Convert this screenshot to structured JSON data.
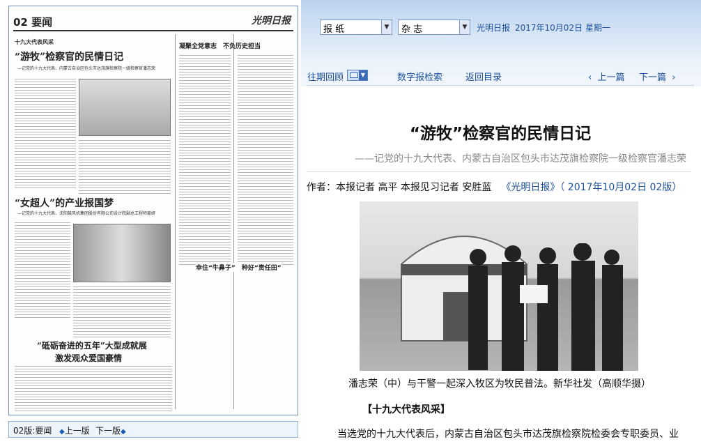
{
  "newspaper_page": {
    "page_label": "02 要闻",
    "masthead": "光明日报",
    "column_label": "十九大代表风采",
    "headline1": "“游牧”检察官的民情日记",
    "headline1_sub": "—记党的十九大代表、内蒙古自治区包头市达茂旗检察院一级检察官潘志荣",
    "headline2": "“女超人”的产业报国梦",
    "headline2_sub": "—记党的十九大代表、沈阳鼓风机集团股份有限公司设计院副总工程师姜妍",
    "headline3a": "“砥砺奋进的五年”大型成就展",
    "headline3b": "激发观众爱国豪情",
    "side_title1": "凝聚全党意志　不负历史担当",
    "side_title2": "幸住“牛鼻子”　种好“责任田”"
  },
  "left_footer": {
    "page": "02版:要闻",
    "prev": "上一版",
    "next": "下一版"
  },
  "top_bar": {
    "select_paper": "报 纸",
    "select_magazine": "杂 志",
    "paper_name": "光明日报",
    "date": "2017年10月02日",
    "weekday": "星期一"
  },
  "nav": {
    "back_issues": "往期回顾",
    "digital_search": "数字报检索",
    "return_toc": "返回目录",
    "prev_page": "上一篇",
    "next_page": "下一篇"
  },
  "article": {
    "title": "“游牧”检察官的民情日记",
    "subtitle": "——记党的十九大代表、内蒙古自治区包头市达茂旗检察院一级检察官潘志荣",
    "authors": "作者：本报记者  高平  本报见习记者  安胜蓝",
    "source": "《光明日报》（ 2017年10月02日   02版）",
    "caption": "潘志荣（中）与干警一起深入牧区为牧民普法。新华社发（高顺华摄）",
    "section_head": "【十九大代表风采】",
    "first_line": "当选党的十九大代表后，内蒙古自治区包头市达茂旗检察院检委会专职委员、业"
  }
}
